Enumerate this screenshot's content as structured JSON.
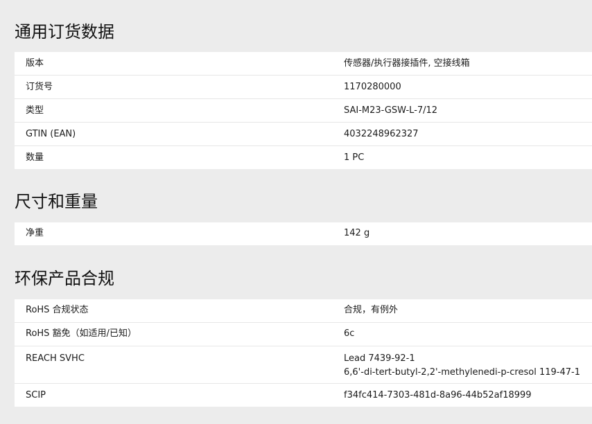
{
  "sections": [
    {
      "title": "通用订货数据",
      "rows": [
        {
          "label": "版本",
          "value": "传感器/执行器接插件, 空接线箱"
        },
        {
          "label": "订货号",
          "value": "1170280000"
        },
        {
          "label": "类型",
          "value": "SAI-M23-GSW-L-7/12"
        },
        {
          "label": "GTIN (EAN)",
          "value": "4032248962327"
        },
        {
          "label": "数量",
          "value": "1  PC"
        }
      ]
    },
    {
      "title": "尺寸和重量",
      "rows": [
        {
          "label": "净重",
          "value": "142  g"
        }
      ]
    },
    {
      "title": "环保产品合规",
      "rows": [
        {
          "label": "RoHS 合规状态",
          "value": "合规，有例外"
        },
        {
          "label": "RoHS 豁免（如适用/已知）",
          "value": "6c"
        },
        {
          "label": "REACH SVHC",
          "value_lines": [
            "Lead 7439-92-1",
            "6,6'-di-tert-butyl-2,2'-methylenedi-p-cresol 119-47-1"
          ]
        },
        {
          "label": "SCIP",
          "value": "f34fc414-7303-481d-8a96-44b52af18999"
        }
      ]
    }
  ]
}
